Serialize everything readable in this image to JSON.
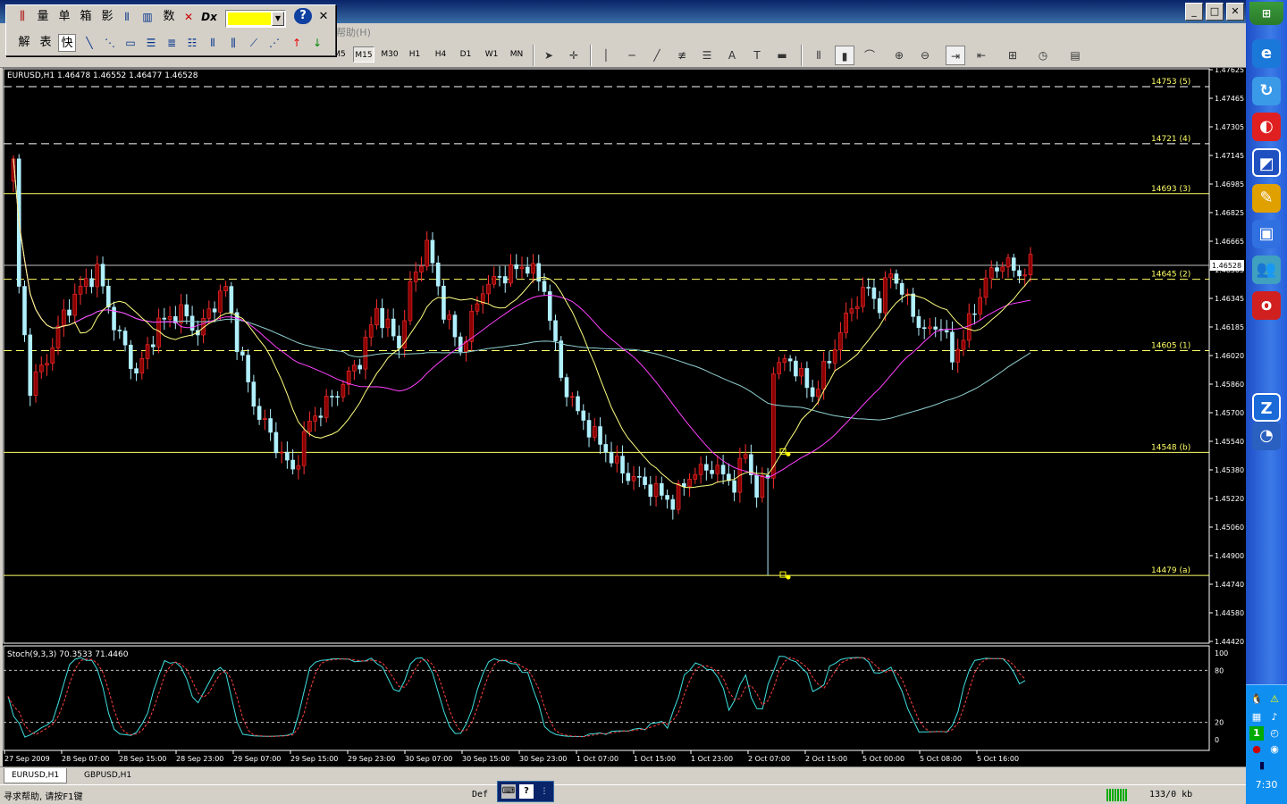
{
  "window": {
    "minimize": "_",
    "maximize": "□",
    "close": "✕",
    "menu_help": "帮助(H)"
  },
  "float_toolbar": {
    "row1": [
      "量",
      "单",
      "箱",
      "影",
      "数"
    ],
    "row2": [
      "解",
      "表",
      "快"
    ],
    "color": "#ffff00",
    "help_icon": "?",
    "close_icon": "✕"
  },
  "toolbar": {
    "timeframes": [
      "M5",
      "M15",
      "M30",
      "H1",
      "H4",
      "D1",
      "W1",
      "MN"
    ],
    "active_timeframe": "M15"
  },
  "chart": {
    "label": "EURUSD,H1  1.46478 1.46552 1.46477 1.46528",
    "price_ticks": [
      "1.47625",
      "1.47465",
      "1.47305",
      "1.47145",
      "1.46985",
      "1.46825",
      "1.46665",
      "1.46505",
      "1.46345",
      "1.46185",
      "1.46020",
      "1.45860",
      "1.45700",
      "1.45540",
      "1.45380",
      "1.45220",
      "1.45060",
      "1.44900",
      "1.44740",
      "1.44580",
      "1.44420"
    ],
    "current_price": "1.46528",
    "levels": [
      {
        "label": "14753 (5)",
        "price": 1.4753,
        "style": "dashed",
        "color": "#ffffff"
      },
      {
        "label": "14721 (4)",
        "price": 1.4721,
        "style": "dashed",
        "color": "#ffffff"
      },
      {
        "label": "14693 (3)",
        "price": 1.4693,
        "style": "solid",
        "color": "#ffff66"
      },
      {
        "label": "14645 (2)",
        "price": 1.4645,
        "style": "dashed",
        "color": "#ffff66"
      },
      {
        "label": "14605 (1)",
        "price": 1.4605,
        "style": "dashed",
        "color": "#ffff66"
      },
      {
        "label": "14548 (b)",
        "price": 1.4548,
        "style": "solid",
        "color": "#ffff66"
      },
      {
        "label": "14479 (a)",
        "price": 1.4479,
        "style": "solid",
        "color": "#ffff66"
      }
    ],
    "time_ticks": [
      "27 Sep 2009",
      "28 Sep 07:00",
      "28 Sep 15:00",
      "28 Sep 23:00",
      "29 Sep 07:00",
      "29 Sep 15:00",
      "29 Sep 23:00",
      "30 Sep 07:00",
      "30 Sep 15:00",
      "30 Sep 23:00",
      "1 Oct 07:00",
      "1 Oct 15:00",
      "1 Oct 23:00",
      "2 Oct 07:00",
      "2 Oct 15:00",
      "5 Oct 00:00",
      "5 Oct 08:00",
      "5 Oct 16:00"
    ],
    "colors": {
      "bull": "#ff3030",
      "bear": "#b0f0ff",
      "bull_body": "#8b0000",
      "ma_fast": "#ffff80",
      "ma_mid": "#ff40ff",
      "ma_slow": "#90d0d0"
    }
  },
  "stoch": {
    "label": "Stoch(9,3,3) 70.3533 71.4460",
    "ticks": [
      "100",
      "80",
      "20",
      "0"
    ],
    "main_color": "#40e0e0",
    "signal_color": "#ff4040"
  },
  "tabs": [
    {
      "label": "EURUSD,H1",
      "active": true
    },
    {
      "label": "GBPUSD,H1",
      "active": false
    }
  ],
  "status": {
    "help": "寻求帮助, 请按F1键",
    "profile": "Def",
    "kb": "133/0 kb"
  },
  "taskbar": {
    "clock": "7:30"
  }
}
